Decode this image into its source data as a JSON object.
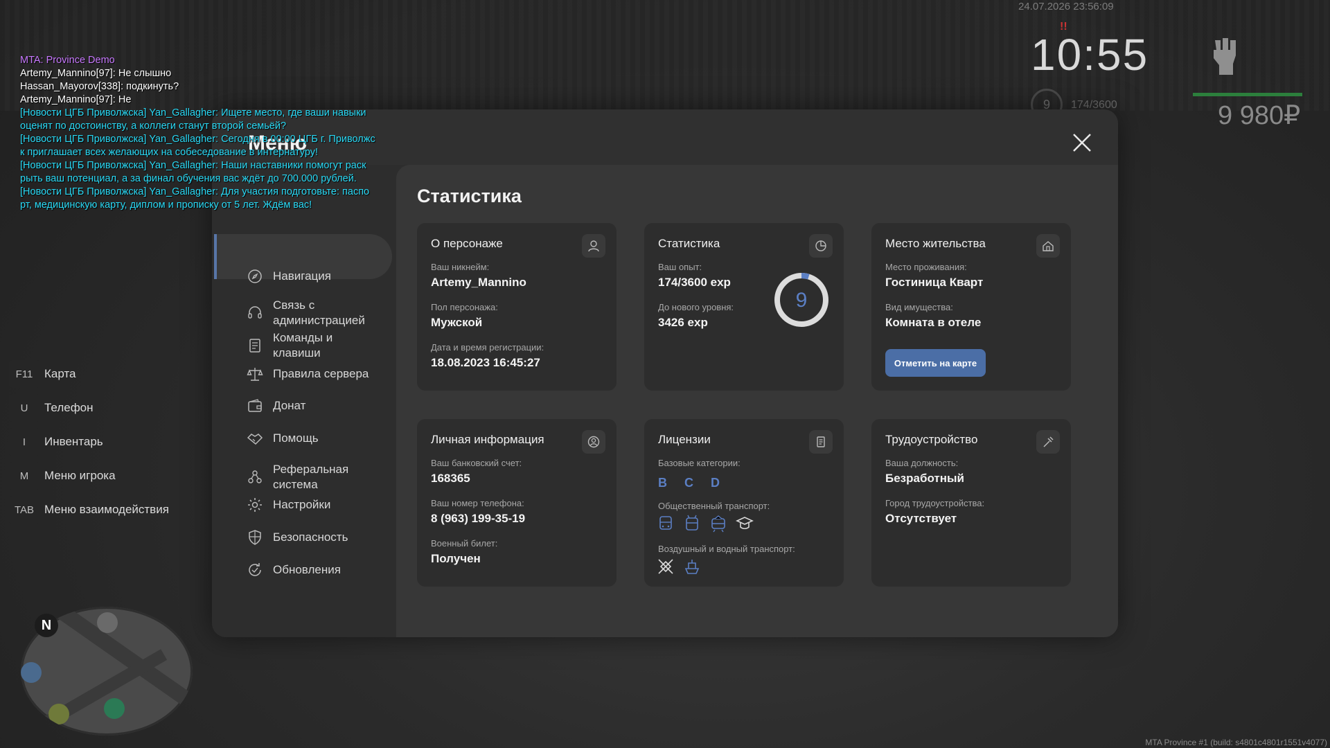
{
  "hud": {
    "datetime": "24.07.2026 23:56:09",
    "time": "10:55",
    "alert": "!!",
    "level": "9",
    "exp": "174/3600",
    "money": "9 980₽",
    "health_color": "#2c7f3c"
  },
  "chat": [
    {
      "text": "MTA: Province Demo",
      "color": "#c879ff"
    },
    {
      "text": "Artemy_Mannino[97]: Не слышно",
      "color": "#ffffff"
    },
    {
      "text": "Hassan_Mayorov[338]: подкинуть?",
      "color": "#ffffff"
    },
    {
      "text": "Artemy_Mannino[97]: Не",
      "color": "#ffffff"
    },
    {
      "text": "[Новости ЦГБ Приволжска] Yan_Gallagher: Ищете место, где ваши навыки\nоценят по достоинству, а коллеги станут второй семьёй?",
      "color": "#29d9f5"
    },
    {
      "text": "[Новости ЦГБ Приволжска] Yan_Gallagher: Сегодня в 00:00 ЦГБ г. Приволжс\nк приглашает всех желающих на собеседование в интернатуру!",
      "color": "#29d9f5"
    },
    {
      "text": "[Новости ЦГБ Приволжска] Yan_Gallagher: Наши наставники помогут раск\nрыть ваш потенциал, а за финал обучения вас ждёт до 700.000 рублей.",
      "color": "#29d9f5"
    },
    {
      "text": "[Новости ЦГБ Приволжска] Yan_Gallagher: Для участия подготовьте: паспо\nрт, медицинскую карту, диплом и прописку от 5 лет. Ждём вас!",
      "color": "#29d9f5"
    }
  ],
  "keys": [
    {
      "key": "F11",
      "label": "Карта"
    },
    {
      "key": "U",
      "label": "Телефон"
    },
    {
      "key": "I",
      "label": "Инвентарь"
    },
    {
      "key": "M",
      "label": "Меню игрока"
    },
    {
      "key": "TAB",
      "label": "Меню взаимодействия"
    }
  ],
  "minimap": {
    "north": "N"
  },
  "build": "MTA Province #1 (build: s4801c4801r1551v4077)",
  "menu": {
    "title": "Меню",
    "sidebar": [
      {
        "label": "Навигация",
        "icon": "compass-icon"
      },
      {
        "label": "Связь с\nадминистрацией",
        "icon": "headset-icon"
      },
      {
        "label": "Команды и\nклавиши",
        "icon": "document-icon"
      },
      {
        "label": "Правила сервера",
        "icon": "scales-icon"
      },
      {
        "label": "Донат",
        "icon": "wallet-icon"
      },
      {
        "label": "Помощь",
        "icon": "handshake-icon"
      },
      {
        "label": "Реферальная\nсистема",
        "icon": "referral-icon"
      },
      {
        "label": "Настройки",
        "icon": "gear-icon"
      },
      {
        "label": "Безопасность",
        "icon": "shield-icon"
      },
      {
        "label": "Обновления",
        "icon": "refresh-icon"
      }
    ],
    "content_title": "Статистика",
    "cards": {
      "character": {
        "title": "О персонаже",
        "nickname_label": "Ваш никнейм:",
        "nickname": "Artemy_Mannino",
        "gender_label": "Пол персонажа:",
        "gender": "Мужской",
        "reg_label": "Дата и время регистрации:",
        "reg": "18.08.2023 16:45:27"
      },
      "stats": {
        "title": "Статистика",
        "exp_label": "Ваш опыт:",
        "exp": "174/3600 exp",
        "next_label": "До нового уровня:",
        "next": "3426 exp",
        "level": "9",
        "level_progress": 0.048
      },
      "residence": {
        "title": "Место жительства",
        "place_label": "Место проживания:",
        "place": "Гостиница Кварт",
        "type_label": "Вид имущества:",
        "type": "Комната в отеле",
        "button": "Отметить на карте"
      },
      "personal": {
        "title": "Личная информация",
        "bank_label": "Ваш банковский счет:",
        "bank": "168365",
        "phone_label": "Ваш номер телефона:",
        "phone": "8 (963) 199-35-19",
        "military_label": "Военный билет:",
        "military": "Получен"
      },
      "licenses": {
        "title": "Лицензии",
        "base_label": "Базовые категории:",
        "base": "B C D",
        "public_label": "Общественный транспорт:",
        "air_label": "Воздушный и водный транспорт:"
      },
      "job": {
        "title": "Трудоустройство",
        "position_label": "Ваша должность:",
        "position": "Безработный",
        "city_label": "Город трудоустройства:",
        "city": "Отсутствует"
      }
    }
  },
  "colors": {
    "accent": "#4b6ea6",
    "license_blue": "#5b7fc4"
  }
}
